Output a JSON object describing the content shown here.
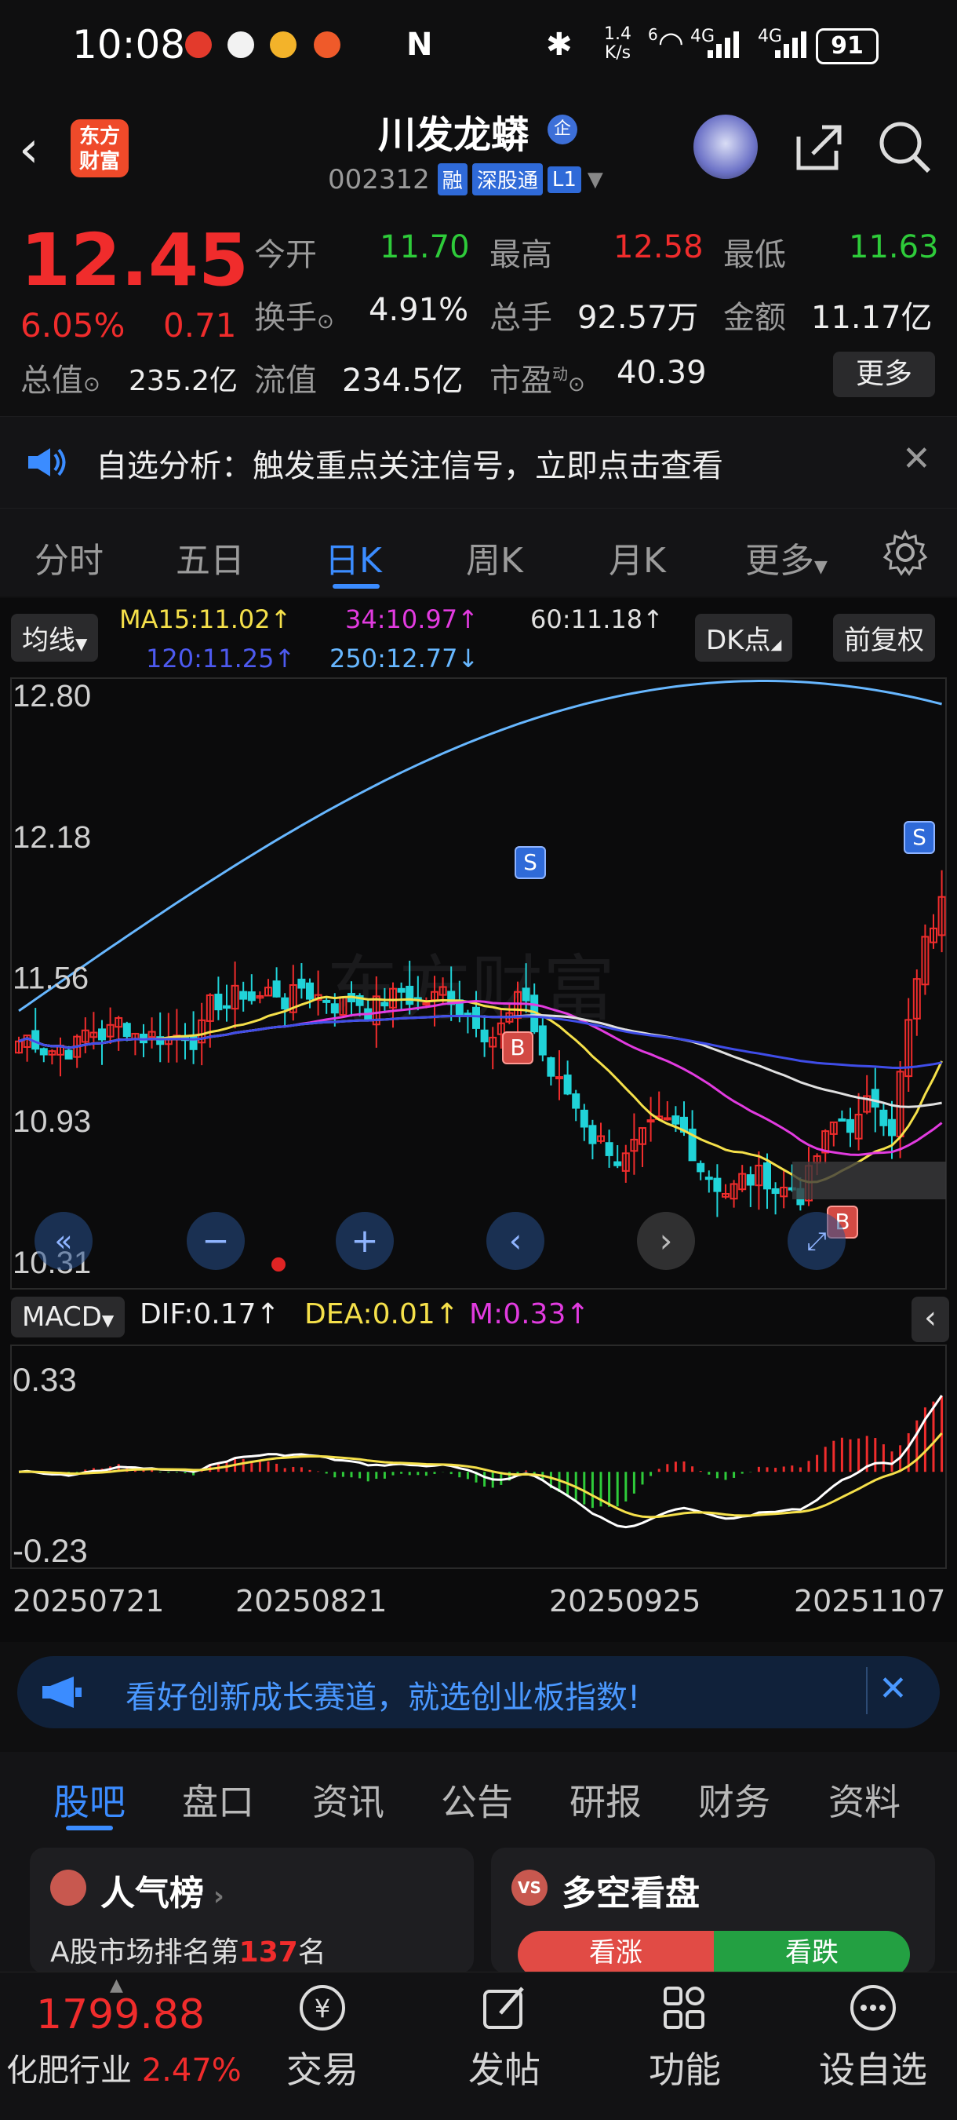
{
  "status": {
    "time": "10:08",
    "net_speed_top": "1.4",
    "net_speed_bottom": "K/s",
    "signal_1": "4G",
    "signal_2": "4G",
    "battery": "91",
    "wifi_badge": "6"
  },
  "header": {
    "logo_line1": "东方",
    "logo_line2": "财富",
    "stock_name": "川发龙蟒",
    "badge_enterprise": "企",
    "stock_code": "002312",
    "tag_margin": "融",
    "tag_connect": "深股通",
    "tag_level": "L1"
  },
  "quote": {
    "price": "12.45",
    "change_pct": "6.05%",
    "change_abs": "0.71",
    "open_label": "今开",
    "open_value": "11.70",
    "high_label": "最高",
    "high_value": "12.58",
    "low_label": "最低",
    "low_value": "11.63",
    "turnover_label": "换手",
    "turnover_value": "4.91%",
    "volume_label": "总手",
    "volume_value": "92.57万",
    "amount_label": "金额",
    "amount_value": "11.17亿",
    "mktcap_label": "总值",
    "mktcap_value": "235.2亿",
    "float_label": "流值",
    "float_value": "234.5亿",
    "pe_label": "市盈",
    "pe_sup": "动",
    "pe_value": "40.39",
    "more_button": "更多"
  },
  "notice": {
    "text": "自选分析：触发重点关注信号，立即点击查看"
  },
  "tabs": [
    "分时",
    "五日",
    "日K",
    "周K",
    "月K",
    "更多"
  ],
  "active_tab": "日K",
  "chart_controls": {
    "ma_selector": "均线",
    "ma15": "MA15:11.02↑",
    "ma34": "34:10.97↑",
    "ma60": "60:11.18↑",
    "ma120": "120:11.25↑",
    "ma250": "250:12.77↓",
    "dk_button": "DK点",
    "adjust_button": "前复权",
    "price_ticks": [
      "12.80",
      "12.18",
      "11.56",
      "10.93",
      "10.31"
    ],
    "signal_s": "S",
    "signal_b": "B",
    "macd_selector": "MACD",
    "dif": "DIF:0.17↑",
    "dea": "DEA:0.01↑",
    "m": "M:0.33↑",
    "macd_ticks": [
      "0.33",
      "-0.23"
    ],
    "dates": [
      "20250721",
      "20250821",
      "20250925",
      "20251107"
    ],
    "watermark": "东方财富"
  },
  "chart_data": {
    "type": "candlestick",
    "title": "",
    "y_range": [
      10.31,
      12.8
    ],
    "dates_shown": [
      "20250721",
      "20250821",
      "20250925",
      "20251107"
    ],
    "moving_averages": [
      {
        "name": "MA15",
        "value": 11.02,
        "color": "#f5e04a"
      },
      {
        "name": "34",
        "value": 10.97,
        "color": "#e23be0"
      },
      {
        "name": "60",
        "value": 11.18,
        "color": "#e0e0e0"
      },
      {
        "name": "120",
        "value": 11.25,
        "color": "#3f4de8"
      },
      {
        "name": "250",
        "value": 12.77,
        "color": "#67b7ff"
      }
    ],
    "macd": {
      "DIF": 0.17,
      "DEA": 0.01,
      "M": 0.33,
      "y_range": [
        -0.23,
        0.33
      ]
    },
    "last_close": 12.45,
    "high": 12.58,
    "low": 11.63
  },
  "ad": {
    "text": "看好创新成长赛道，就选创业板指数!"
  },
  "subtabs": [
    "股吧",
    "盘口",
    "资讯",
    "公告",
    "研报",
    "财务",
    "资料"
  ],
  "active_subtab": "股吧",
  "cards": {
    "popularity_title": "人气榜",
    "popularity_text_prefix": "A股市场排名第",
    "popularity_rank": "137",
    "popularity_text_suffix": "名",
    "vs_title": "多空看盘",
    "vs_icon": "VS",
    "bull_label": "看涨",
    "bear_label": "看跌"
  },
  "bottom": {
    "index_value": "1799.88",
    "index_name": "化肥行业",
    "index_change": "2.47%",
    "nav": [
      "交易",
      "发帖",
      "功能",
      "设自选"
    ]
  },
  "colors": {
    "up": "#f02c2c",
    "down": "#20d3d8",
    "accent_blue": "#3b8cff",
    "green": "#2ecb3a"
  }
}
